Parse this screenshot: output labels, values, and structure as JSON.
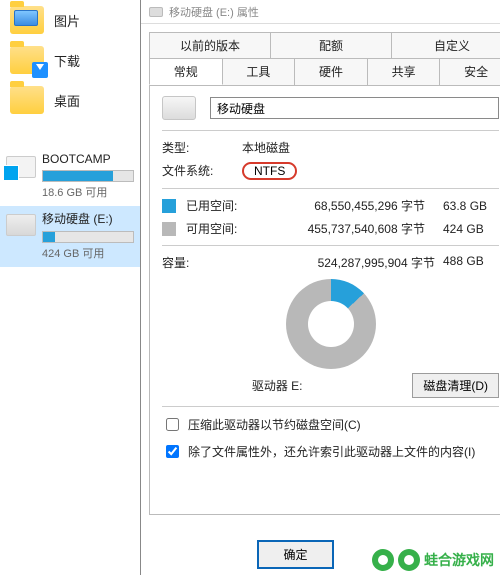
{
  "shortcuts": {
    "pictures": "图片",
    "downloads": "下载",
    "desktop": "桌面"
  },
  "drives": {
    "bootcamp": {
      "title": "BOOTCAMP",
      "sub": "18.6 GB 可用",
      "fill_pct": 78
    },
    "mobile": {
      "title": "移动硬盘 (E:)",
      "sub": "424 GB 可用",
      "fill_pct": 13
    }
  },
  "dialog": {
    "title": "移动硬盘 (E:) 属性",
    "tabs_top": {
      "prev": "以前的版本",
      "quota": "配额",
      "custom": "自定义"
    },
    "tabs_bottom": {
      "general": "常规",
      "tools": "工具",
      "hardware": "硬件",
      "sharing": "共享",
      "security": "安全"
    },
    "name_value": "移动硬盘",
    "type_label": "类型:",
    "type_value": "本地磁盘",
    "fs_label": "文件系统:",
    "fs_value": "NTFS",
    "used_label": "已用空间:",
    "used_bytes": "68,550,455,296 字节",
    "used_gb": "63.8 GB",
    "free_label": "可用空间:",
    "free_bytes": "455,737,540,608 字节",
    "free_gb": "424 GB",
    "cap_label": "容量:",
    "cap_bytes": "524,287,995,904 字节",
    "cap_gb": "488 GB",
    "drive_caption": "驱动器 E:",
    "cleanup_btn": "磁盘清理(D)",
    "compress_label": "压缩此驱动器以节约磁盘空间(C)",
    "index_label": "除了文件属性外，还允许索引此驱动器上文件的内容(I)",
    "ok": "确定"
  },
  "chart_data": {
    "type": "pie",
    "title": "驱动器 E:",
    "series": [
      {
        "name": "已用空间",
        "value": 63.8,
        "unit": "GB",
        "color": "#26a0da"
      },
      {
        "name": "可用空间",
        "value": 424,
        "unit": "GB",
        "color": "#b8b8b8"
      }
    ],
    "total": {
      "label": "容量",
      "value": 488,
      "unit": "GB"
    }
  },
  "watermark": "蛙合游戏网"
}
